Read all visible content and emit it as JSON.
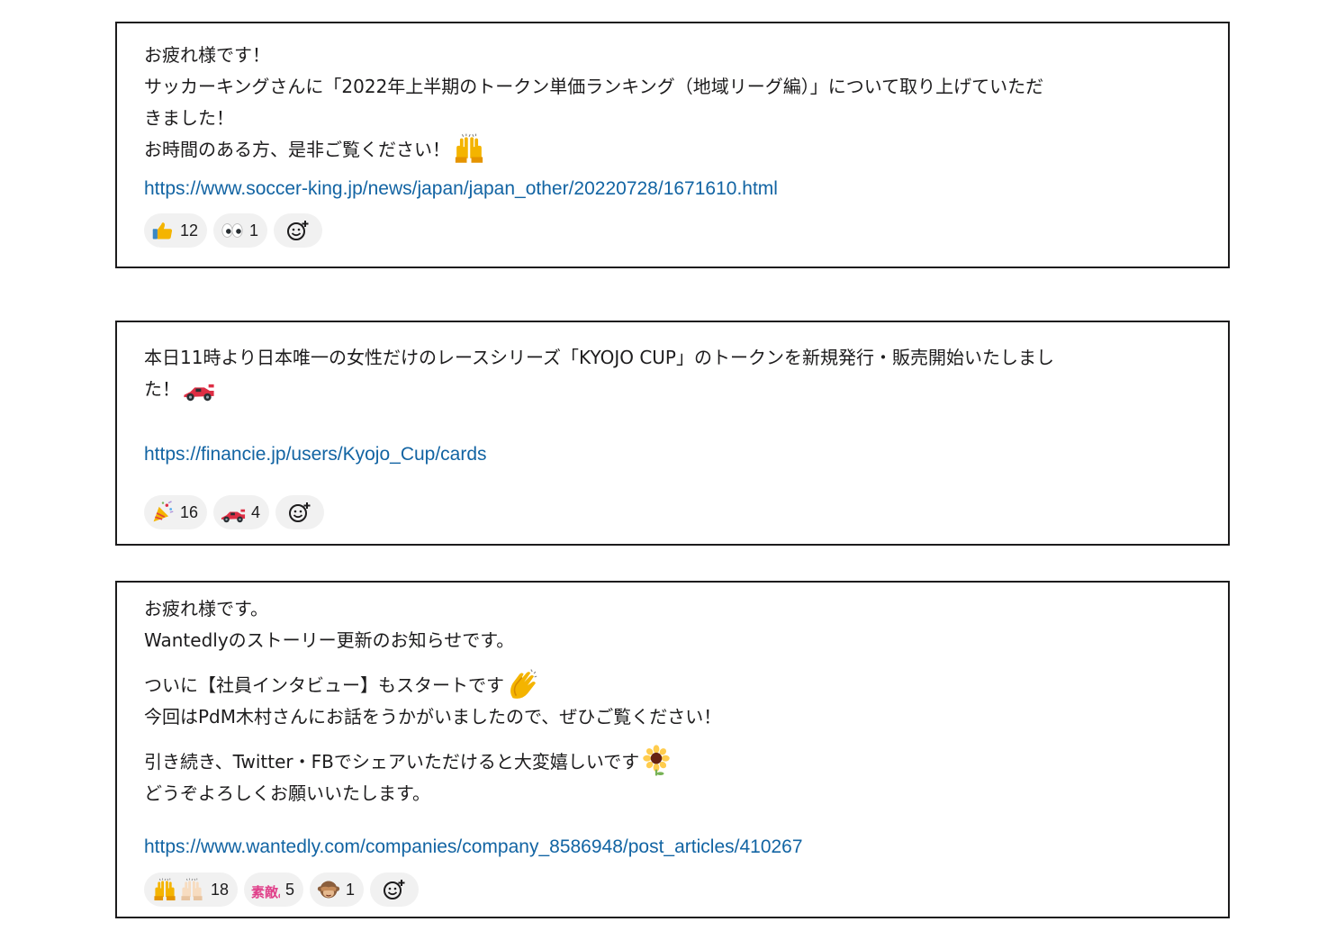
{
  "messages": [
    {
      "lines": [
        "お疲れ様です！",
        "サッカーキングさんに「2022年上半期のトークン単価ランキング（地域リーグ編）」について取り上げていただ",
        "きました！",
        "お時間のある方、是非ご覧ください！"
      ],
      "inline_emoji": "raised-hands",
      "link": "https://www.soccer-king.jp/news/japan/japan_other/20220728/1671610.html",
      "reactions": [
        {
          "emoji": "thumbs-up",
          "count": "12"
        },
        {
          "emoji": "eyes",
          "count": "1"
        }
      ]
    },
    {
      "lines": [
        "本日11時より日本唯一の女性だけのレースシリーズ「KYOJO CUP」のトークンを新規発行・販売開始いたしまし",
        "た！"
      ],
      "inline_emoji": "racing-car",
      "link": "https://financie.jp/users/Kyojo_Cup/cards",
      "reactions": [
        {
          "emoji": "party-popper",
          "count": "16"
        },
        {
          "emoji": "racing-car",
          "count": "4"
        }
      ]
    },
    {
      "lines": [
        "お疲れ様です。",
        "Wantedlyのストーリー更新のお知らせです。",
        "ついに【社員インタビュー】もスタートです",
        "今回はPdM木村さんにお話をうかがいましたので、ぜひご覧ください！",
        "引き続き、Twitter・FBでシェアいただけると大変嬉しいです",
        "どうぞよろしくお願いいたします。"
      ],
      "inline_emojis": [
        "clapping-hands",
        "sunflower"
      ],
      "link": "https://www.wantedly.com/companies/company_8586948/post_articles/410267",
      "reactions": [
        {
          "emoji": "raised-hands-pair",
          "count": "18"
        },
        {
          "emoji": "subarashii-stamp",
          "stamp_text": "素敵。",
          "count": "5"
        },
        {
          "emoji": "see-no-evil-monkey",
          "count": "1"
        }
      ]
    }
  ],
  "colors": {
    "link": "#1264a3",
    "pill": "#f1f1f1",
    "text": "#1d1c1d",
    "border": "#1d1c1d"
  }
}
